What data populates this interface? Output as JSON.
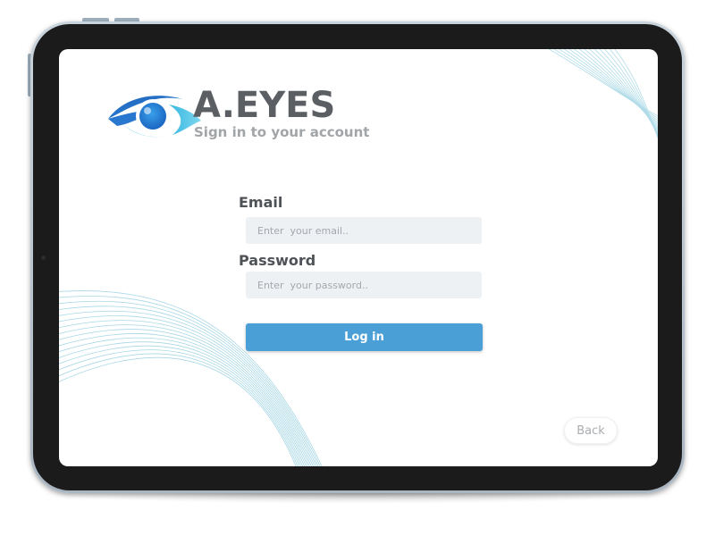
{
  "app": {
    "brand_title": "A.EYES",
    "brand_subtitle": "Sign in to your account",
    "logo_icon": "eye-icon"
  },
  "form": {
    "email_label": "Email",
    "email_placeholder": "Enter  your email..",
    "email_value": "",
    "password_label": "Password",
    "password_placeholder": "Enter  your password..",
    "password_value": "",
    "login_label": "Log in"
  },
  "nav": {
    "back_label": "Back"
  },
  "colors": {
    "accent": "#4aa0d6",
    "title_text": "#5b5f63",
    "subtitle_text": "#a2a5a8",
    "input_background": "#eef1f4",
    "device_bezel": "#1b1b1b"
  }
}
